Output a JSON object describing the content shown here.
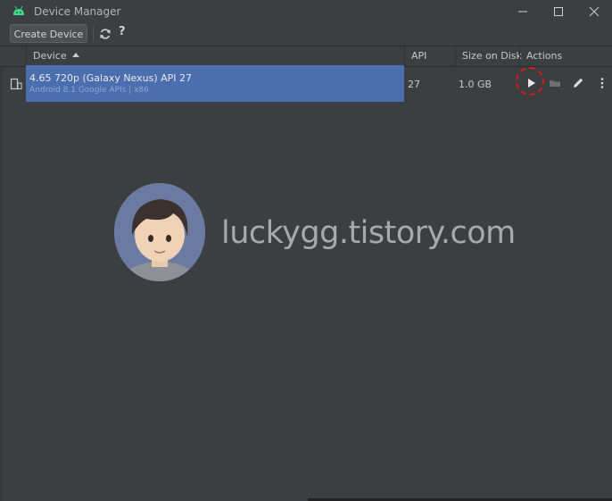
{
  "window": {
    "title": "Device Manager",
    "minimize_icon": "minimize-icon",
    "maximize_icon": "maximize-icon",
    "close_icon": "close-icon"
  },
  "toolbar": {
    "create_label": "Create Device",
    "refresh_icon": "refresh-icon",
    "help_label": "?"
  },
  "table": {
    "columns": [
      "Device",
      "API",
      "Size on Disk",
      "Actions"
    ],
    "rows": [
      {
        "name": "4.65  720p (Galaxy Nexus) API 27",
        "subtitle": "Android 8.1 Google APIs | x86",
        "api": "27",
        "size": "1.0 GB",
        "actions": [
          "play-icon",
          "folder-icon",
          "edit-icon",
          "more-icon"
        ]
      }
    ]
  },
  "watermark": {
    "text": "luckygg.tistory.com"
  },
  "colors": {
    "background": "#3c3f41",
    "selection": "#4b6eaf",
    "highlight_ring": "#d81a1a",
    "android_green": "#3ddc84"
  }
}
